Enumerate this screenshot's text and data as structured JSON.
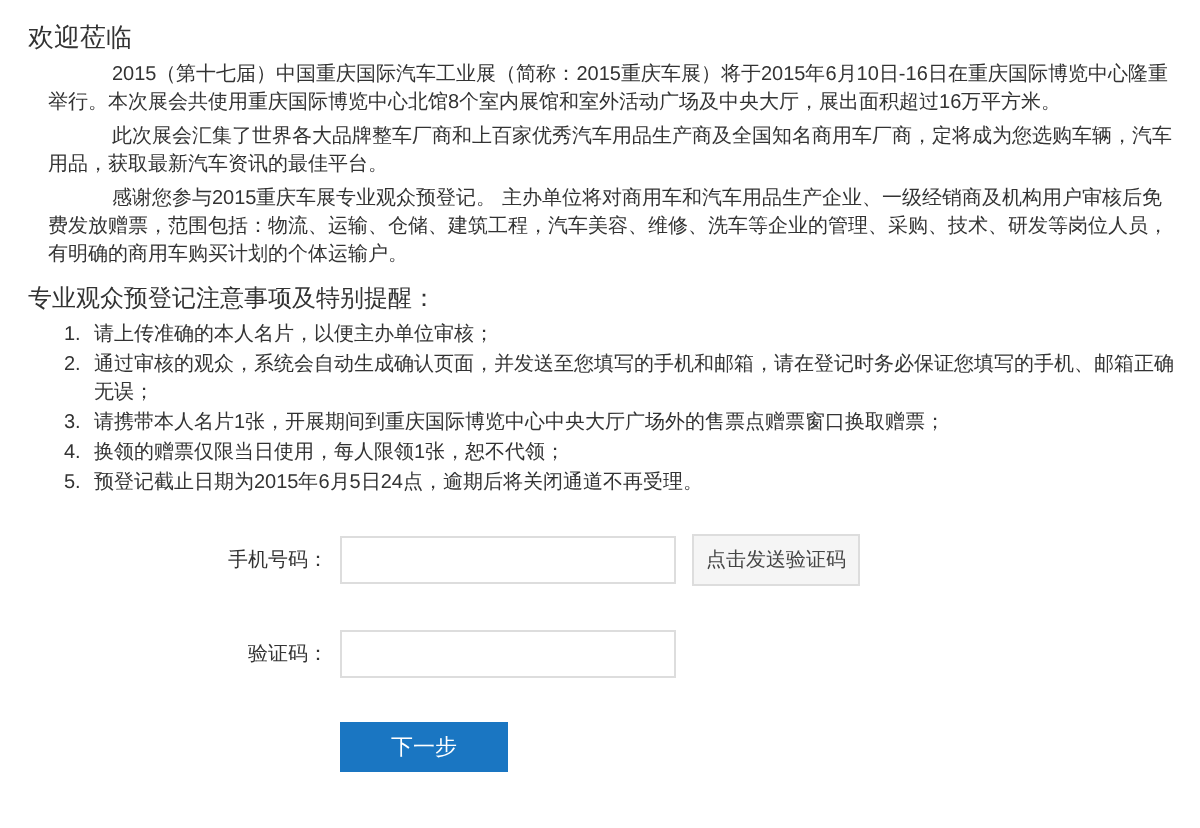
{
  "welcome": {
    "title": "欢迎莅临",
    "paragraphs": [
      "2015（第十七届）中国重庆国际汽车工业展（简称：2015重庆车展）将于2015年6月10日-16日在重庆国际博览中心隆重举行。本次展会共使用重庆国际博览中心北馆8个室内展馆和室外活动广场及中央大厅，展出面积超过16万平方米。",
      "此次展会汇集了世界各大品牌整车厂商和上百家优秀汽车用品生产商及全国知名商用车厂商，定将成为您选购车辆，汽车用品，获取最新汽车资讯的最佳平台。",
      "感谢您参与2015重庆车展专业观众预登记。 主办单位将对商用车和汽车用品生产企业、一级经销商及机构用户审核后免费发放赠票，范围包括：物流、运输、仓储、建筑工程，汽车美容、维修、洗车等企业的管理、采购、技术、研发等岗位人员，有明确的商用车购买计划的个体运输户。"
    ]
  },
  "notice": {
    "title": "专业观众预登记注意事项及特别提醒：",
    "items": [
      {
        "number": "1.",
        "text": "请上传准确的本人名片，以便主办单位审核；"
      },
      {
        "number": "2.",
        "text": "通过审核的观众，系统会自动生成确认页面，并发送至您填写的手机和邮箱，请在登记时务必保证您填写的手机、邮箱正确无误；"
      },
      {
        "number": "3.",
        "text": "请携带本人名片1张，开展期间到重庆国际博览中心中央大厅广场外的售票点赠票窗口换取赠票；"
      },
      {
        "number": "4.",
        "text": "换领的赠票仅限当日使用，每人限领1张，恕不代领；"
      },
      {
        "number": "5.",
        "text": "预登记截止日期为2015年6月5日24点，逾期后将关闭通道不再受理。"
      }
    ]
  },
  "form": {
    "fields": [
      {
        "kind": "with_action",
        "label": "手机号码：",
        "action": "点击发送验证码"
      },
      {
        "kind": "plain",
        "label": "验证码："
      }
    ],
    "submit": "下一步"
  }
}
